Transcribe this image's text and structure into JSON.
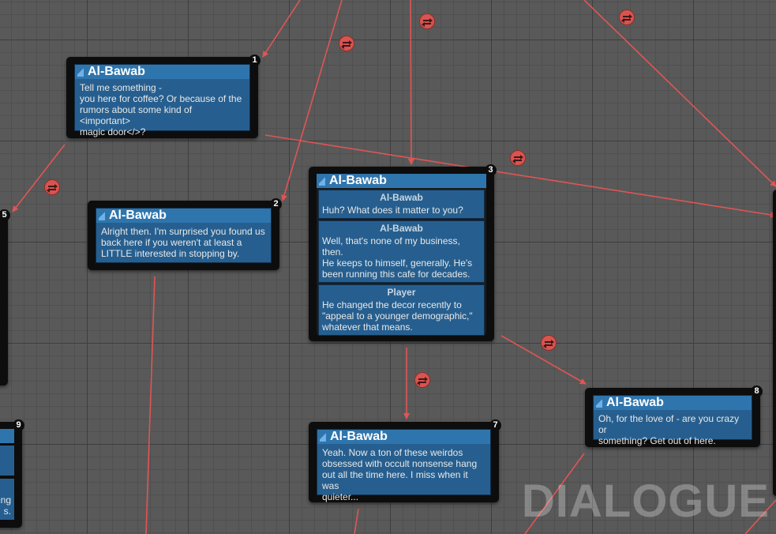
{
  "graph": {
    "watermark": "DIALOGUE",
    "wire_color": "#e05555",
    "node_color": "#2f75ad",
    "nodes": [
      {
        "num": "1",
        "speaker": "Al-Bawab",
        "text": "Tell me something -\nyou here for coffee? Or because of the\nrumors about some kind of <important>\nmagic door</>?"
      },
      {
        "num": "2",
        "speaker": "Al-Bawab",
        "text": "Alright then. I'm surprised you found us\nback here if you weren't at least a\nLITTLE interested in stopping by."
      },
      {
        "num": "3",
        "speaker": "Al-Bawab",
        "fragments": [
          {
            "speaker": "Al-Bawab",
            "text": "Huh? What does it matter to you?"
          },
          {
            "speaker": "Al-Bawab",
            "text": "Well, that's none of my business, then.\nHe keeps to himself, generally. He's\nbeen running this cafe for decades."
          },
          {
            "speaker": "Player",
            "text": "He changed the decor recently to\n\"appeal to a younger demographic,\"\nwhatever that means."
          }
        ]
      },
      {
        "num": "5"
      },
      {
        "num": "7",
        "speaker": "Al-Bawab",
        "text": "Yeah. Now a ton of these weirdos\nobsessed with occult nonsense hang\nout all the time here. I miss when it was\nquieter..."
      },
      {
        "num": "8",
        "speaker": "Al-Bawab",
        "text": "Oh, for the love of - are you crazy or\nsomething? Get out of here."
      },
      {
        "num": "9",
        "fragments": [
          {
            "text": "ng\ns."
          }
        ]
      }
    ]
  }
}
